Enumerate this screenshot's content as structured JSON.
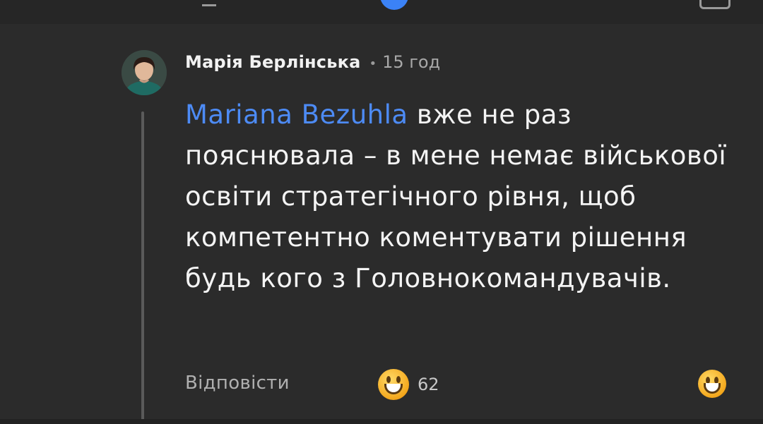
{
  "comment": {
    "author": "Марія Берлінська",
    "time": "15 год",
    "mention": "Mariana Bezuhla",
    "text": " вже не раз пояснювала – в мене немає військової освіти стратегічного рівня, щоб компетентно коментувати рішення будь кого з Головнокомандувачів.",
    "reply_label": "Відповісти",
    "reaction_count": "62"
  },
  "colors": {
    "mention": "#4d8bf5",
    "background": "#2b2b2b"
  },
  "icons": {
    "reaction": "grinning-face-icon"
  }
}
